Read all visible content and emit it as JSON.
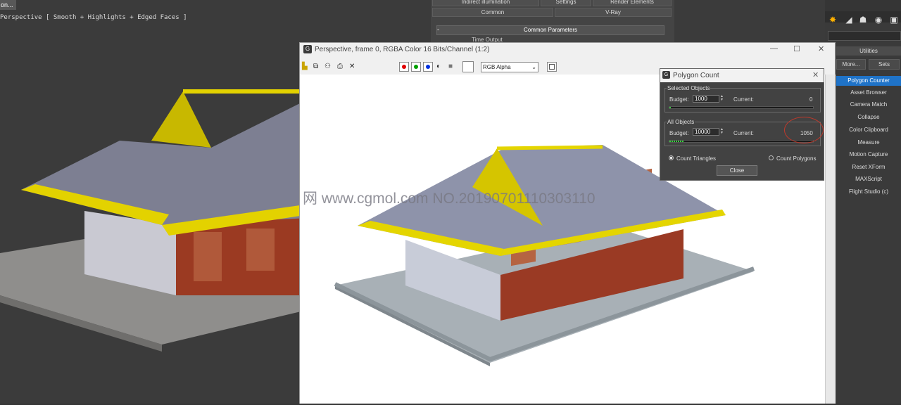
{
  "viewport": {
    "menu_tab": "on...",
    "label": "Perspective [ Smooth + Highlights + Edged Faces ]"
  },
  "render_setup": {
    "tabs_row1": [
      "Indirect illumination",
      "Settings",
      "Render Elements"
    ],
    "tabs_row2": [
      "Common",
      "V-Ray"
    ],
    "rollout_title": "Common Parameters",
    "rollout_toggle": "-",
    "section_label": "Time Output"
  },
  "frame_window": {
    "title": "Perspective, frame 0, RGBA Color 16 Bits/Channel (1:2)",
    "channel_select": "RGB Alpha",
    "window_buttons": [
      "—",
      "☐",
      "✕"
    ],
    "channel_colors": [
      "#e00000",
      "#00a000",
      "#0030e0"
    ]
  },
  "watermark": "网 www.cgmol.com NO.20190701110303110",
  "polygon_count": {
    "title": "Polygon Count",
    "selected": {
      "group": "Selected Objects",
      "budget_label": "Budget:",
      "budget": "1000",
      "current_label": "Current:",
      "current": "0"
    },
    "all": {
      "group": "All Objects",
      "budget_label": "Budget:",
      "budget": "10000",
      "current_label": "Current:",
      "current": "1050"
    },
    "count_triangles": "Count Triangles",
    "count_polygons": "Count Polygons",
    "close": "Close",
    "selected_mode": "Count Triangles"
  },
  "command_panel": {
    "header": "Utilities",
    "more_button": "More...",
    "sets_button": "Sets",
    "items": [
      "Polygon Counter",
      "Asset Browser",
      "Camera Match",
      "Collapse",
      "Color Clipboard",
      "Measure",
      "Motion Capture",
      "Reset XForm",
      "MAXScript",
      "Flight Studio (c)"
    ],
    "active_item": "Polygon Counter",
    "active_color": "#1f73c8"
  }
}
